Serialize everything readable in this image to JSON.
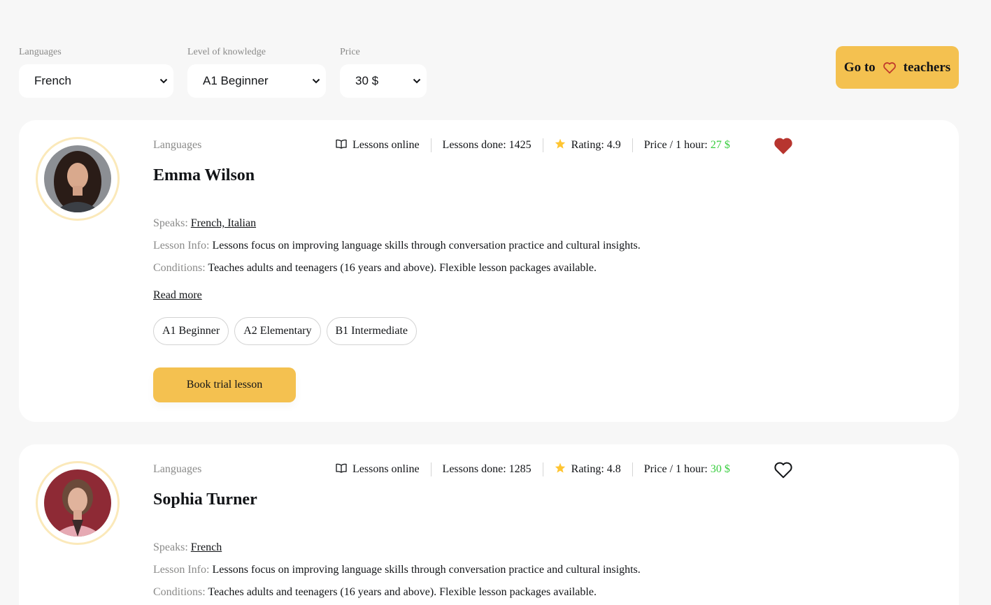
{
  "filters": {
    "languages": {
      "label": "Languages",
      "value": "French"
    },
    "level": {
      "label": "Level of knowledge",
      "value": "A1 Beginner"
    },
    "price": {
      "label": "Price",
      "value": "30 $"
    }
  },
  "goto_button": {
    "prefix": "Go to",
    "suffix": "teachers",
    "icon": "heart-icon"
  },
  "accent_color": "#f4c150",
  "price_color": "#38cd3e",
  "teachers": [
    {
      "languages_label": "Languages",
      "name": "Emma Wilson",
      "lessons_online": "Lessons online",
      "lessons_done": "Lessons done: 1425",
      "rating": "Rating: 4.9",
      "price_label": "Price / 1 hour:",
      "price": "27 $",
      "favorite": true,
      "speaks_label": "Speaks:",
      "speaks": "French, Italian",
      "lesson_info_label": "Lesson Info:",
      "lesson_info": "Lessons focus on improving language skills through conversation practice and cultural insights.",
      "conditions_label": "Conditions:",
      "conditions": "Teaches adults and teenagers (16 years and above). Flexible lesson packages available.",
      "read_more": "Read more",
      "levels": [
        "A1 Beginner",
        "A2 Elementary",
        "B1 Intermediate"
      ],
      "book_label": "Book trial lesson"
    },
    {
      "languages_label": "Languages",
      "name": "Sophia Turner",
      "lessons_online": "Lessons online",
      "lessons_done": "Lessons done: 1285",
      "rating": "Rating: 4.8",
      "price_label": "Price / 1 hour:",
      "price": "30 $",
      "favorite": false,
      "speaks_label": "Speaks:",
      "speaks": "French",
      "lesson_info_label": "Lesson Info:",
      "lesson_info": "Lessons focus on improving language skills through conversation practice and cultural insights.",
      "conditions_label": "Conditions:",
      "conditions": "Teaches adults and teenagers (16 years and above). Flexible lesson packages available."
    }
  ]
}
